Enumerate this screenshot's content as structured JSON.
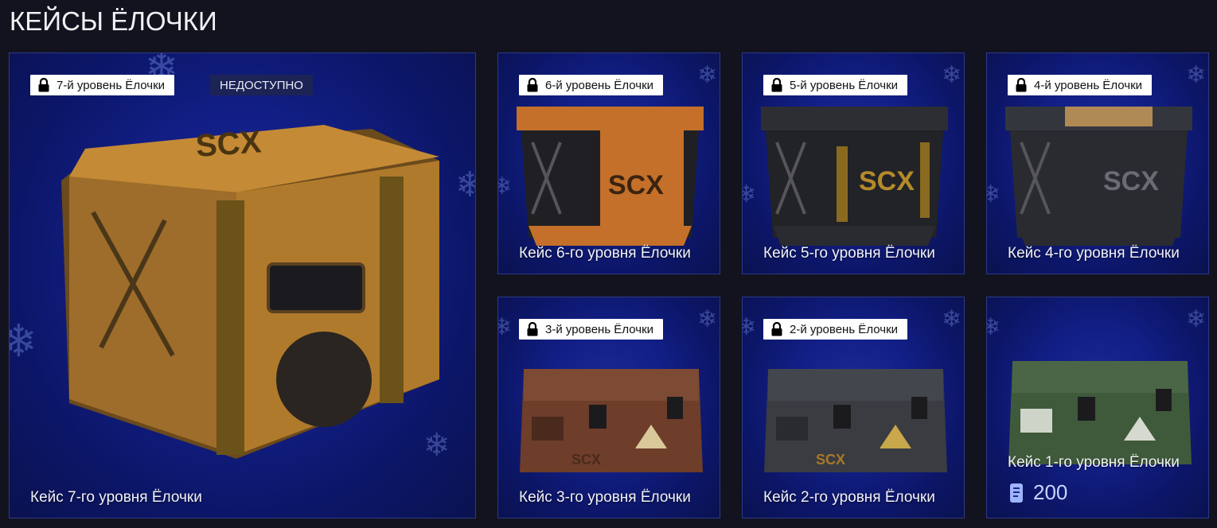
{
  "page": {
    "title": "КЕЙСЫ ЁЛОЧКИ"
  },
  "cases": [
    {
      "level_badge": "7-й уровень Ёлочки",
      "status": "НЕДОСТУПНО",
      "name": "Кейс 7-го уровня Ёлочки",
      "color": "#b07a2c"
    },
    {
      "level_badge": "6-й уровень Ёлочки",
      "name": "Кейс 6-го уровня Ёлочки",
      "color": "#c4702a"
    },
    {
      "level_badge": "5-й уровень Ёлочки",
      "name": "Кейс 5-го уровня Ёлочки",
      "color": "#2a2b31"
    },
    {
      "level_badge": "4-й уровень Ёлочки",
      "name": "Кейс 4-го уровня Ёлочки",
      "color": "#34363d"
    },
    {
      "level_badge": "3-й уровень Ёлочки",
      "name": "Кейс 3-го уровня Ёлочки",
      "color": "#6e3e2a"
    },
    {
      "level_badge": "2-й уровень Ёлочки",
      "name": "Кейс 2-го уровня Ёлочки",
      "color": "#3a3c42"
    },
    {
      "name": "Кейс 1-го уровня Ёлочки",
      "price": "200",
      "color": "#3f5a3b"
    }
  ],
  "icons": {
    "lock": "lock-icon",
    "currency": "coin-icon",
    "snowflake": "snowflake-icon"
  }
}
